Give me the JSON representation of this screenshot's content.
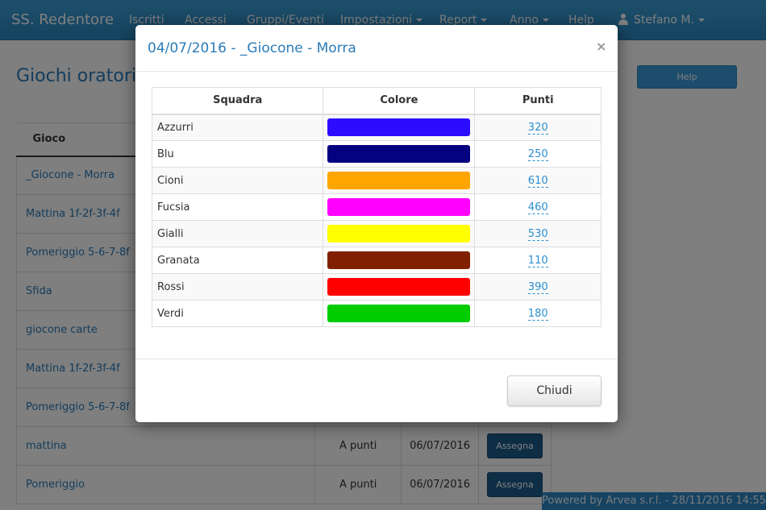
{
  "navbar": {
    "brand": "SS. Redentore",
    "items": [
      "Iscritti",
      "Accessi",
      "Gruppi/Eventi",
      "Impostazioni",
      "Report",
      "Anno",
      "Help"
    ],
    "user": "Stefano M."
  },
  "page": {
    "title": "Giochi oratori",
    "help_label": "Help",
    "table": {
      "header": "Gioco",
      "rows": [
        {
          "name": "_Giocone - Morra"
        },
        {
          "name": "Mattina 1f-2f-3f-4f"
        },
        {
          "name": "Pomeriggio 5-6-7-8f"
        },
        {
          "name": "Sfida"
        },
        {
          "name": "giocone carte"
        },
        {
          "name": "Mattina 1f-2f-3f-4f"
        },
        {
          "name": "Pomeriggio 5-6-7-8f"
        },
        {
          "name": "mattina",
          "tipo": "A punti",
          "data": "06/07/2016",
          "action": "Assegna"
        },
        {
          "name": "Pomeriggio",
          "tipo": "A punti",
          "data": "06/07/2016",
          "action": "Assegna"
        }
      ]
    }
  },
  "footer": "Powered by Arvea s.r.l. - 28/11/2016 14:55",
  "modal": {
    "title": "04/07/2016 - _Giocone - Morra",
    "close_symbol": "×",
    "columns": [
      "Squadra",
      "Colore",
      "Punti"
    ],
    "teams": [
      {
        "name": "Azzurri",
        "color": "#2b0cff",
        "points": "320"
      },
      {
        "name": "Blu",
        "color": "#050180",
        "points": "250"
      },
      {
        "name": "Cioni",
        "color": "#ffa500",
        "points": "610"
      },
      {
        "name": "Fucsia",
        "color": "#ff00ff",
        "points": "460"
      },
      {
        "name": "Gialli",
        "color": "#ffff00",
        "points": "530"
      },
      {
        "name": "Granata",
        "color": "#812000",
        "points": "110"
      },
      {
        "name": "Rossi",
        "color": "#ff0000",
        "points": "390"
      },
      {
        "name": "Verdi",
        "color": "#00cc00",
        "points": "180"
      }
    ],
    "close_button": "Chiudi"
  }
}
